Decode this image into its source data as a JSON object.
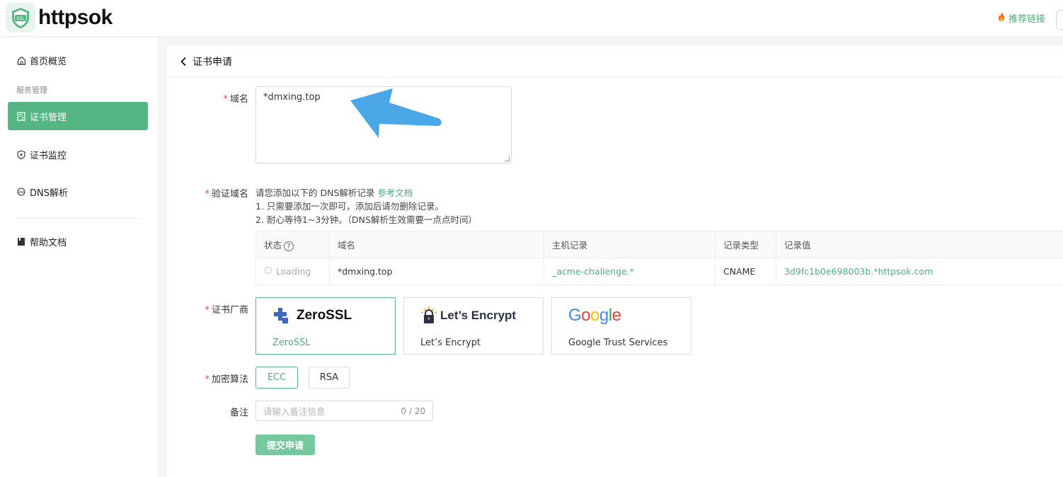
{
  "app": {
    "name": "httpsok",
    "logo_text": "SSL"
  },
  "header": {
    "recommend_link": "推荐链接"
  },
  "sidebar": {
    "overview": "首页概览",
    "group_label": "服务管理",
    "items": [
      {
        "label": "证书管理",
        "icon": "certificate-icon",
        "active": true
      },
      {
        "label": "证书监控",
        "icon": "shield-icon",
        "active": false
      },
      {
        "label": "DNS解析",
        "icon": "dns-icon",
        "active": false
      }
    ],
    "help": "帮助文档"
  },
  "page": {
    "title": "证书申请"
  },
  "form": {
    "domain_label": "域名",
    "domain_value": "*dmxing.top",
    "verify_label": "验证域名",
    "verify_intro": "请您添加以下的 DNS解析记录 ",
    "verify_doc_link": "参考文档",
    "verify_step1": "1. 只需要添加一次即可，添加后请勿删除记录。",
    "verify_step2": "2. 耐心等待1~3分钟。（DNS解析生效需要一点点时间）",
    "dns_table": {
      "headers": [
        "状态",
        "域名",
        "主机记录",
        "记录类型",
        "记录值"
      ],
      "row": {
        "status": "Loading",
        "domain": "*dmxing.top",
        "host": "_acme-challenge.*",
        "type": "CNAME",
        "value": "3d9fc1b0e698003b.*httpsok.com"
      }
    },
    "vendor_label": "证书厂商",
    "vendors": [
      {
        "name": "ZeroSSL",
        "logo_text": "ZeroSSL",
        "selected": true
      },
      {
        "name": "Let’s Encrypt",
        "logo_text": "Let’s Encrypt",
        "selected": false
      },
      {
        "name": "Google Trust Services",
        "logo_text": "Google",
        "selected": false
      }
    ],
    "algo_label": "加密算法",
    "algos": [
      {
        "label": "ECC",
        "selected": true
      },
      {
        "label": "RSA",
        "selected": false
      }
    ],
    "remark_label": "备注",
    "remark_placeholder": "请输入备注信息",
    "remark_counter": "0 / 20",
    "submit_label": "提交申请"
  },
  "colors": {
    "accent": "#56b683",
    "required": "#e05050",
    "arrow": "#4aa8e8"
  }
}
